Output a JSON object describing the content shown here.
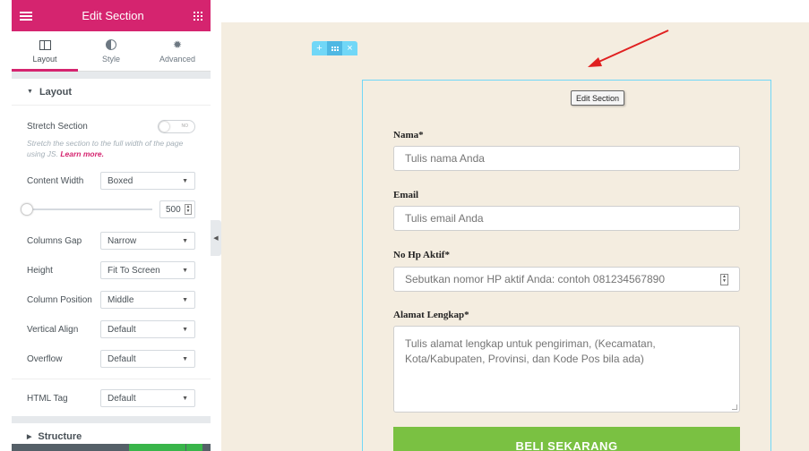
{
  "panel": {
    "title": "Edit Section",
    "tabs": [
      {
        "label": "Layout",
        "active": true
      },
      {
        "label": "Style",
        "active": false
      },
      {
        "label": "Advanced",
        "active": false
      }
    ],
    "layout_section": {
      "heading": "Layout",
      "stretch": {
        "label": "Stretch Section",
        "toggle_text": "NO"
      },
      "stretch_desc": "Stretch the section to the full width of the page using JS.",
      "learn_more": "Learn more.",
      "content_width": {
        "label": "Content Width",
        "value": "Boxed"
      },
      "width_slider": {
        "value": "500"
      },
      "columns_gap": {
        "label": "Columns Gap",
        "value": "Narrow"
      },
      "height": {
        "label": "Height",
        "value": "Fit To Screen"
      },
      "column_position": {
        "label": "Column Position",
        "value": "Middle"
      },
      "vertical_align": {
        "label": "Vertical Align",
        "value": "Default"
      },
      "overflow": {
        "label": "Overflow",
        "value": "Default"
      },
      "html_tag": {
        "label": "HTML Tag",
        "value": "Default"
      }
    },
    "structure_heading": "Structure"
  },
  "preview": {
    "tooltip": "Edit Section",
    "form": {
      "name_label": "Nama*",
      "name_placeholder": "Tulis nama Anda",
      "email_label": "Email",
      "email_placeholder": "Tulis email Anda",
      "phone_label": "No Hp Aktif*",
      "phone_placeholder": "Sebutkan nomor HP aktif Anda: contoh 081234567890",
      "address_label": "Alamat Lengkap*",
      "address_placeholder": "Tulis alamat lengkap untuk pengiriman, (Kecamatan, Kota/Kabupaten, Provinsi, dan Kode Pos bila ada)",
      "submit_label": "BELI SEKARANG"
    }
  },
  "colors": {
    "brand": "#d5246f",
    "canvas": "#f4ede0",
    "handle": "#71d7f7",
    "submit": "#7ac142",
    "arrow": "#e02020"
  }
}
